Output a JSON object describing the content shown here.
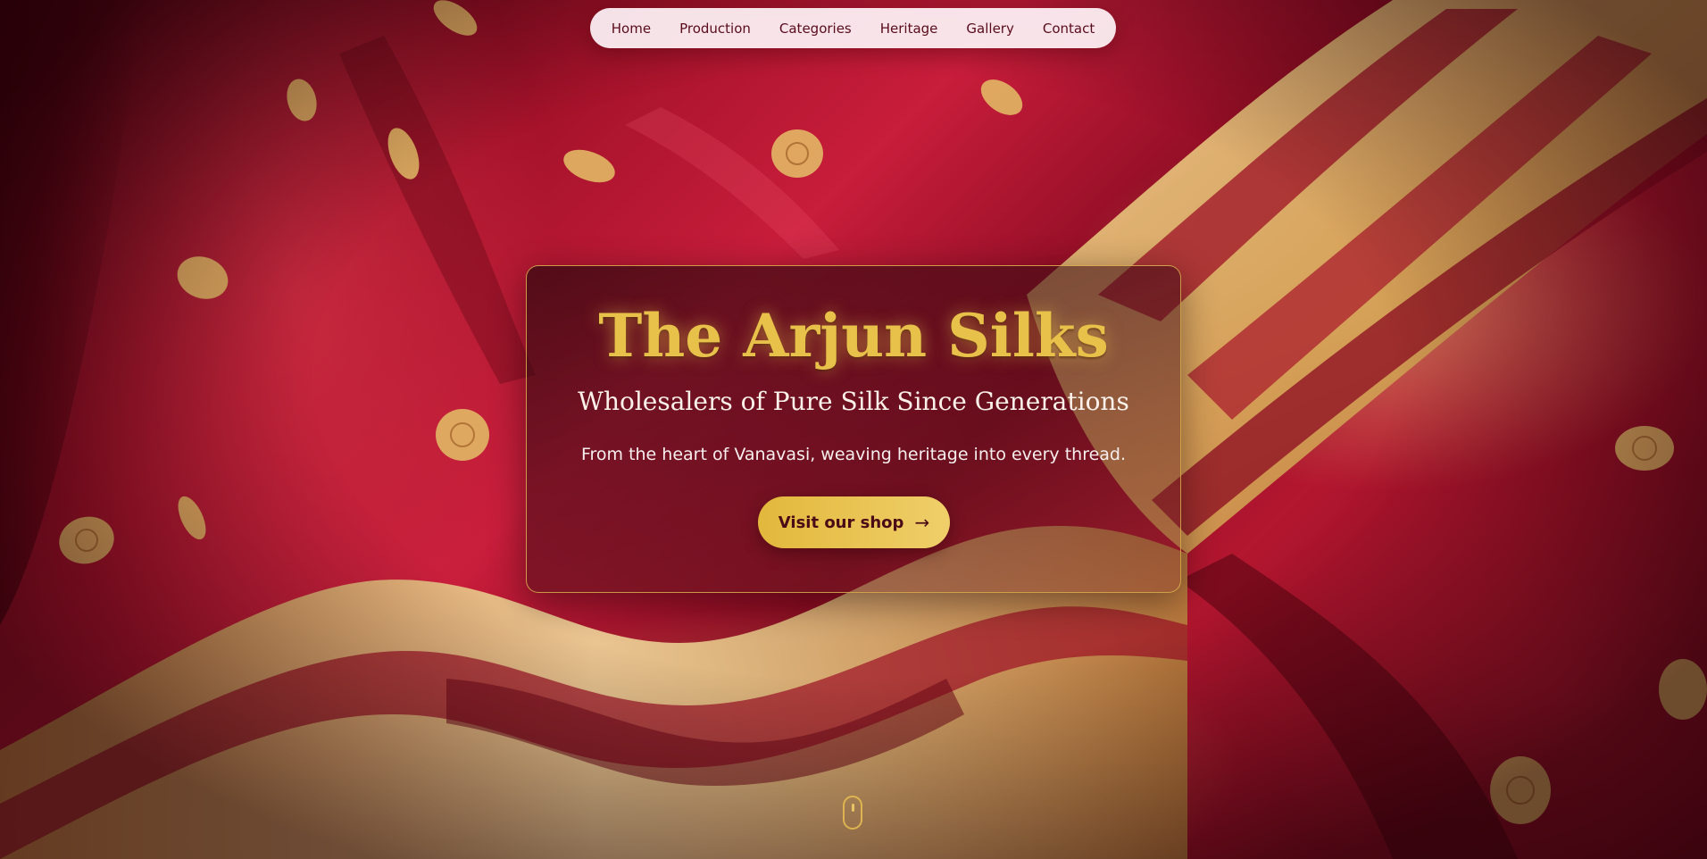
{
  "nav": {
    "items": [
      {
        "label": "Home"
      },
      {
        "label": "Production"
      },
      {
        "label": "Categories"
      },
      {
        "label": "Heritage"
      },
      {
        "label": "Gallery"
      },
      {
        "label": "Contact"
      }
    ]
  },
  "hero": {
    "title": "The Arjun Silks",
    "subtitle": "Wholesalers of Pure Silk Since Generations",
    "tagline": "From the heart of Vanavasi, weaving heritage into every thread.",
    "cta_label": "Visit our shop",
    "cta_arrow": "→"
  },
  "colors": {
    "silk_red": "#b3162f",
    "gold_accent": "#e8c14a",
    "nav_bg": "#fcf0f4",
    "nav_text": "#5a0c1c"
  },
  "icons": {
    "cta": "arrow-right-icon",
    "scroll": "mouse-scroll-icon"
  }
}
